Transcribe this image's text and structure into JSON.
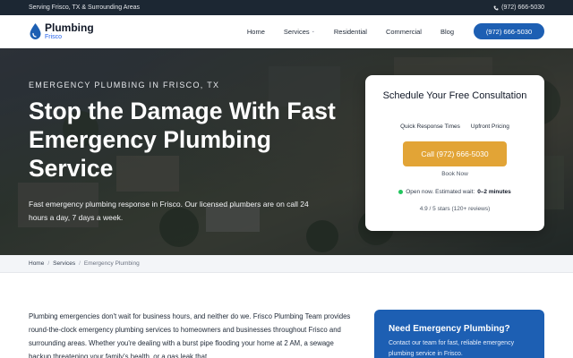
{
  "topbar": {
    "service_area": "Serving Frisco, TX & Surrounding Areas",
    "phone": "(972) 666-5030"
  },
  "nav": {
    "logo_main": "Plumbing",
    "logo_sub": "Frisco",
    "items": [
      {
        "label": "Home"
      },
      {
        "label": "Services"
      },
      {
        "label": "Residential"
      },
      {
        "label": "Commercial"
      },
      {
        "label": "Blog"
      }
    ],
    "cta": "(972) 666-5030"
  },
  "hero": {
    "kicker": "EMERGENCY PLUMBING IN FRISCO, TX",
    "headline": "Stop the Damage With Fast Emergency Plumbing Service",
    "text": "Fast emergency plumbing response in Frisco. Our licensed plumbers are on call 24 hours a day, 7 days a week."
  },
  "card": {
    "title": "Schedule Your Free Consultation",
    "tags": [
      "Quick Response Times",
      "Upfront Pricing"
    ],
    "button": "Call (972) 666-5030",
    "book": "Book Now",
    "status": "Open now. Estimated wait:",
    "wait": "0–2 minutes",
    "rating": "4.9 / 5 stars (120+ reviews)"
  },
  "breadcrumb": [
    "Home",
    "Services",
    "Emergency Plumbing"
  ],
  "content": {
    "paragraph": "Plumbing emergencies don't wait for business hours, and neither do we. Frisco Plumbing Team provides round-the-clock emergency plumbing services to homeowners and businesses throughout Frisco and surrounding areas. Whether you're dealing with a burst pipe flooding your home at 2 AM, a sewage backup threatening your family's health, or a gas leak that"
  },
  "sidecard": {
    "title": "Need Emergency Plumbing?",
    "text": "Contact our team for fast, reliable emergency plumbing service in Frisco."
  },
  "colors": {
    "topbar": "#1c2733",
    "brand_blue": "#1d5fb3",
    "cta_orange": "#e2a436",
    "status_green": "#22c55e"
  },
  "icons": [
    "phone-icon",
    "water-drop-logo-icon",
    "chevron-down-icon"
  ]
}
